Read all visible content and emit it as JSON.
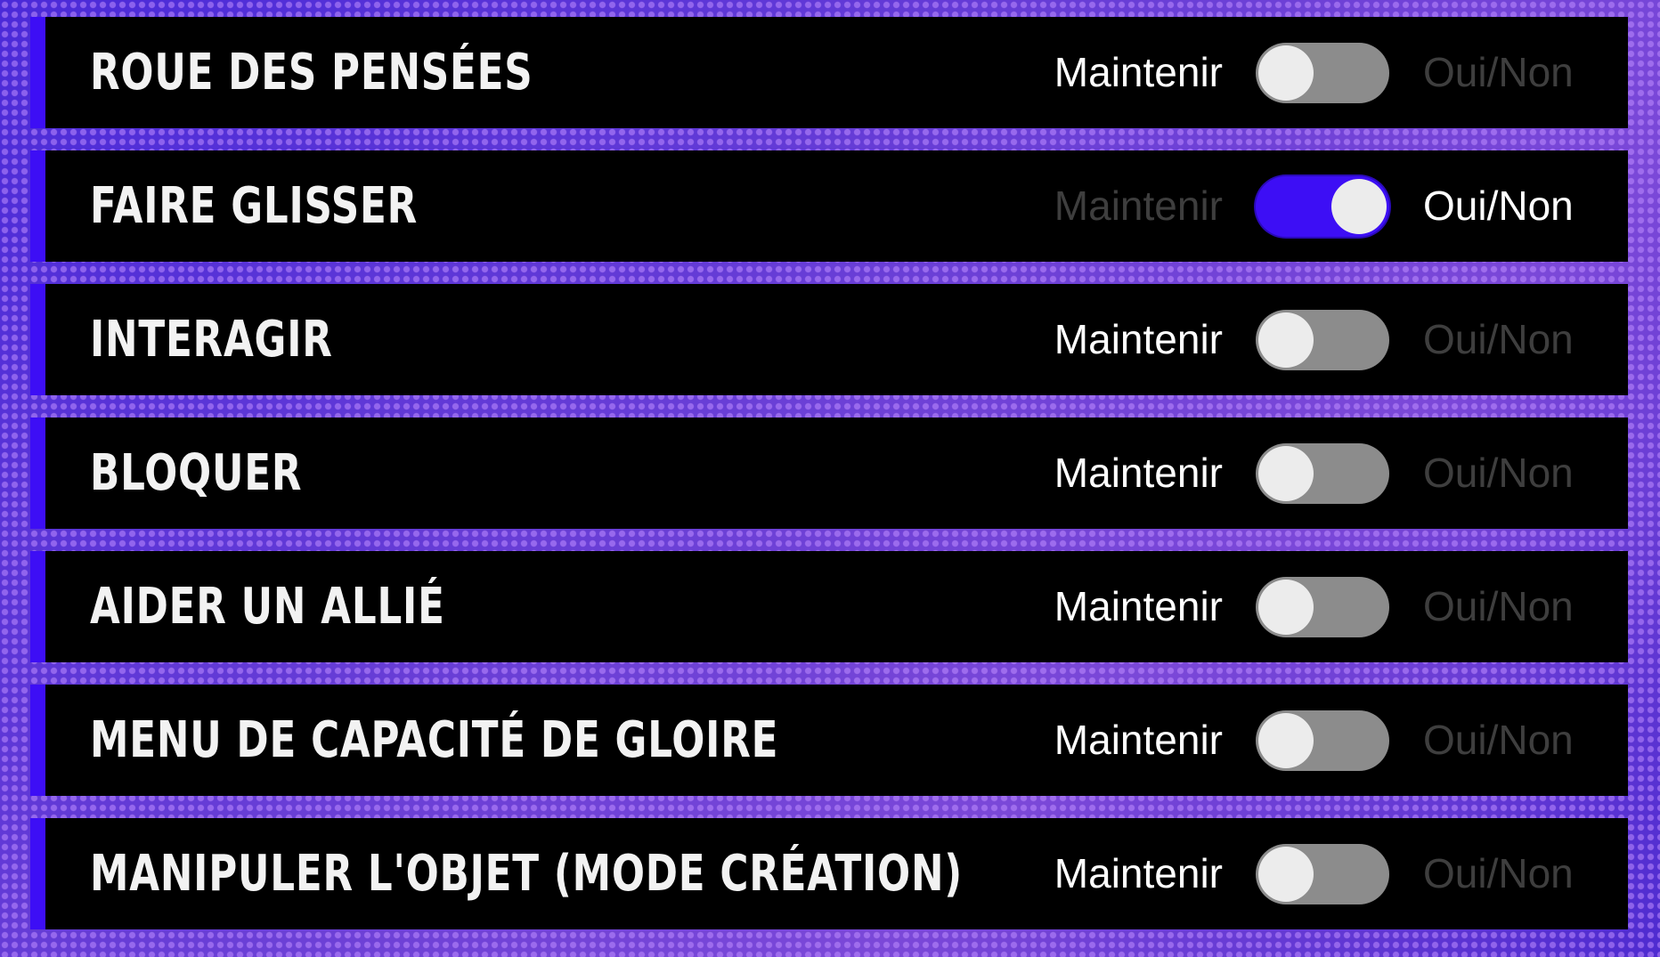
{
  "settings": {
    "hold_label": "Maintenir",
    "toggle_label": "Oui/Non",
    "items": [
      {
        "title": "ROUE DES PENSÉES",
        "mode": "Maintenir"
      },
      {
        "title": "FAIRE GLISSER",
        "mode": "Oui/Non"
      },
      {
        "title": "INTERAGIR",
        "mode": "Maintenir"
      },
      {
        "title": "BLOQUER",
        "mode": "Maintenir"
      },
      {
        "title": "AIDER UN ALLIÉ",
        "mode": "Maintenir"
      },
      {
        "title": "MENU DE CAPACITÉ DE GLOIRE",
        "mode": "Maintenir"
      },
      {
        "title": "MANIPULER L'OBJET (MODE CRÉATION)",
        "mode": "Maintenir"
      }
    ]
  },
  "colors": {
    "accent": "#3d0ef5",
    "row_background": "#000000",
    "active_text": "#ffffff",
    "inactive_text": "#3e3e3e",
    "switch_off": "#8c8c8c",
    "knob": "#ececec"
  }
}
